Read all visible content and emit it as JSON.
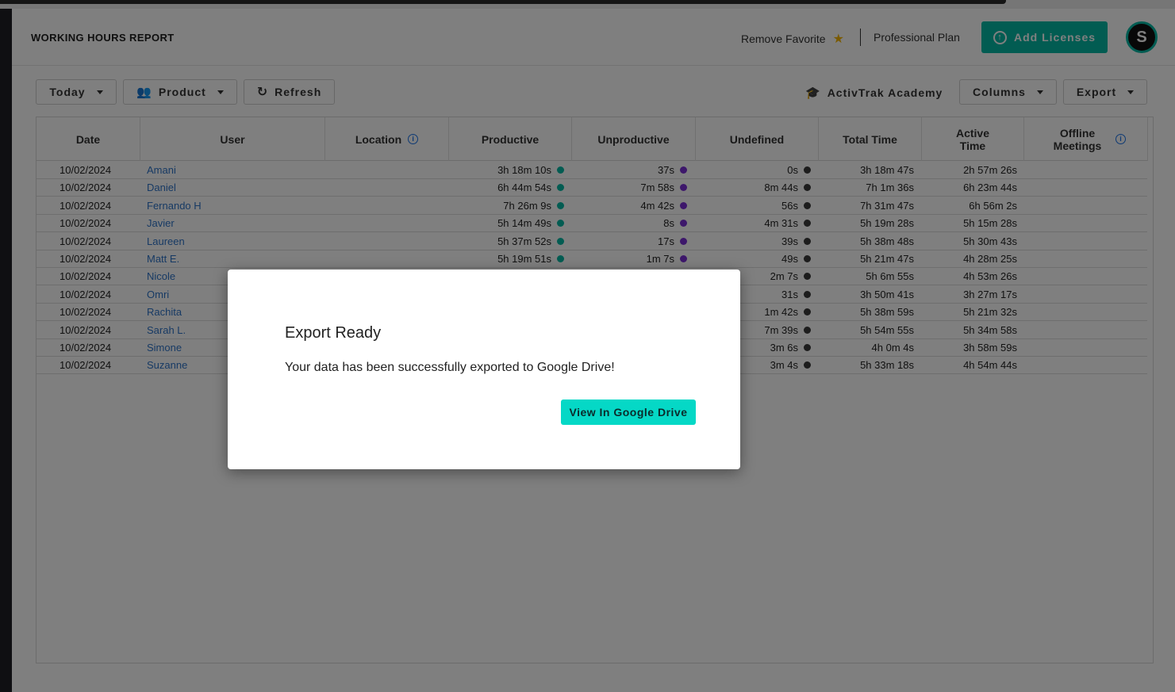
{
  "header": {
    "title": "WORKING HOURS REPORT",
    "favorite_label": "Remove Favorite",
    "plan_label": "Professional Plan",
    "add_licenses_label": "Add Licenses",
    "avatar_initial": "S"
  },
  "toolbar": {
    "date_filter": "Today",
    "group_filter": "Product",
    "refresh_label": "Refresh",
    "academy_label": "ActivTrak Academy",
    "columns_label": "Columns",
    "export_label": "Export"
  },
  "table": {
    "columns": [
      "Date",
      "User",
      "Location",
      "Productive",
      "Unproductive",
      "Undefined",
      "Total Time",
      "Active Time",
      "Offline Meetings"
    ],
    "dot_colors": {
      "productive": "#05b9a4",
      "unproductive": "#7b2fd6",
      "undefined": "#3a3a3a"
    },
    "rows": [
      {
        "date": "10/02/2024",
        "user": "Amani",
        "productive": "3h 18m 10s",
        "unproductive": "37s",
        "undefined": "0s",
        "total": "3h 18m 47s",
        "active": "2h 57m 26s"
      },
      {
        "date": "10/02/2024",
        "user": "Daniel",
        "productive": "6h 44m 54s",
        "unproductive": "7m 58s",
        "undefined": "8m 44s",
        "total": "7h 1m 36s",
        "active": "6h 23m 44s"
      },
      {
        "date": "10/02/2024",
        "user": "Fernando H",
        "productive": "7h 26m 9s",
        "unproductive": "4m 42s",
        "undefined": "56s",
        "total": "7h 31m 47s",
        "active": "6h 56m 2s"
      },
      {
        "date": "10/02/2024",
        "user": "Javier",
        "productive": "5h 14m 49s",
        "unproductive": "8s",
        "undefined": "4m 31s",
        "total": "5h 19m 28s",
        "active": "5h 15m 28s"
      },
      {
        "date": "10/02/2024",
        "user": "Laureen",
        "productive": "5h 37m 52s",
        "unproductive": "17s",
        "undefined": "39s",
        "total": "5h 38m 48s",
        "active": "5h 30m 43s"
      },
      {
        "date": "10/02/2024",
        "user": "Matt E.",
        "productive": "5h 19m 51s",
        "unproductive": "1m 7s",
        "undefined": "49s",
        "total": "5h 21m 47s",
        "active": "4h 28m 25s"
      },
      {
        "date": "10/02/2024",
        "user": "Nicole",
        "productive": "",
        "unproductive": "",
        "undefined": "2m 7s",
        "total": "5h 6m 55s",
        "active": "4h 53m 26s"
      },
      {
        "date": "10/02/2024",
        "user": "Omri",
        "productive": "",
        "unproductive": "",
        "undefined": "31s",
        "total": "3h 50m 41s",
        "active": "3h 27m 17s"
      },
      {
        "date": "10/02/2024",
        "user": "Rachita",
        "productive": "",
        "unproductive": "",
        "undefined": "1m 42s",
        "total": "5h 38m 59s",
        "active": "5h 21m 32s"
      },
      {
        "date": "10/02/2024",
        "user": "Sarah L.",
        "productive": "",
        "unproductive": "",
        "undefined": "7m 39s",
        "total": "5h 54m 55s",
        "active": "5h 34m 58s"
      },
      {
        "date": "10/02/2024",
        "user": "Simone",
        "productive": "",
        "unproductive": "",
        "undefined": "3m 6s",
        "total": "4h 0m 4s",
        "active": "3h 58m 59s"
      },
      {
        "date": "10/02/2024",
        "user": "Suzanne",
        "productive": "",
        "unproductive": "",
        "undefined": "3m 4s",
        "total": "5h 33m 18s",
        "active": "4h 54m 44s"
      }
    ]
  },
  "modal": {
    "title": "Export Ready",
    "message": "Your data has been successfully exported to Google Drive!",
    "button_label": "View In Google Drive"
  }
}
